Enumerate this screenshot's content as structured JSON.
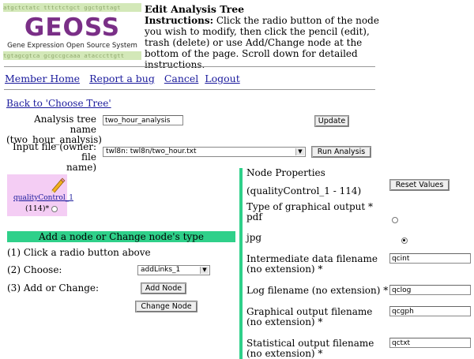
{
  "logo": {
    "dna_top": "atgctctatc tttctctgct ggctgttagt",
    "word": "GEOSS",
    "subtitle": "Gene Expression Open Source System",
    "dna_bottom": "tgtagcgtca gcgccgcaaa atacccttgtt",
    "word_color": "#7a2f87"
  },
  "header": {
    "title": "Edit Analysis Tree",
    "instr_label": "Instructions:",
    "instr_text": " Click the radio button of the node you wish to modify, then click the pencil (edit), trash (delete) or use Add/Change node at the bottom of the page. Scroll down for detailed instructions."
  },
  "nav": {
    "member_home": "Member Home",
    "report_bug": "Report a bug",
    "cancel": "Cancel",
    "logout": "Logout"
  },
  "back_link": "Back to 'Choose Tree'",
  "tree_form": {
    "name_label_1": "Analysis tree name",
    "name_label_2": "(two_hour_analysis)",
    "name_value": "two_hour_analysis",
    "update_button": "Update",
    "input_label_1": "Input file (owner: file",
    "input_label_2": "name)",
    "input_value": "twl8n: twl8n/two_hour.txt",
    "run_button": "Run Analysis"
  },
  "tree_node": {
    "icon": "pencil-icon",
    "name": "qualityControl_1",
    "id_text": "(114)*"
  },
  "add_section": {
    "title": "Add a node or Change node's type",
    "step1": "(1) Click a radio button above",
    "step2": "(2) Choose:",
    "choose_value": "addLinks_1",
    "step3": "(3) Add or Change:",
    "add_button": "Add Node",
    "change_button": "Change Node"
  },
  "props": {
    "title": "Node Properties",
    "node_id": "(qualityControl_1 - 114)",
    "reset_button": "Reset Values",
    "graph_type_label": "Type of graphical output *",
    "opt_pdf": "pdf",
    "opt_jpg": "jpg",
    "intermediate_label": "Intermediate data filename (no extension) *",
    "intermediate_value": "qcint",
    "log_label": "Log filename (no extension) *",
    "log_value": "qclog",
    "graphical_label": "Graphical output filename (no extension) *",
    "graphical_value": "qcgph",
    "statistical_label": "Statistical output filename (no extension) *",
    "statistical_value": "qctxt"
  },
  "colors": {
    "accent_green": "#2fd08a",
    "node_bg": "#f4cdf4",
    "link": "#1a1a9c"
  }
}
